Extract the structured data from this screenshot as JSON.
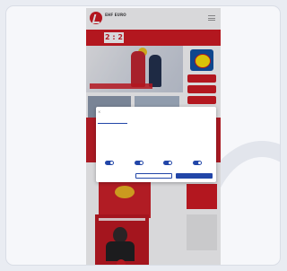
{
  "site": {
    "brand": "EHF EURO",
    "score": "2 : 2",
    "hero_caption": "",
    "sidebar_buttons": [
      "",
      "",
      ""
    ]
  },
  "consent": {
    "close_glyph": "×",
    "title": "",
    "tabs": [
      "",
      "",
      "",
      ""
    ],
    "heading": "",
    "body": "",
    "toggles": [
      {
        "label": "",
        "on": true
      },
      {
        "label": "",
        "on": true
      },
      {
        "label": "",
        "on": true
      },
      {
        "label": "",
        "on": true
      }
    ],
    "buttons": [
      "",
      ""
    ]
  },
  "colors": {
    "brand_red": "#d2141c",
    "consent_blue": "#2246a8"
  }
}
